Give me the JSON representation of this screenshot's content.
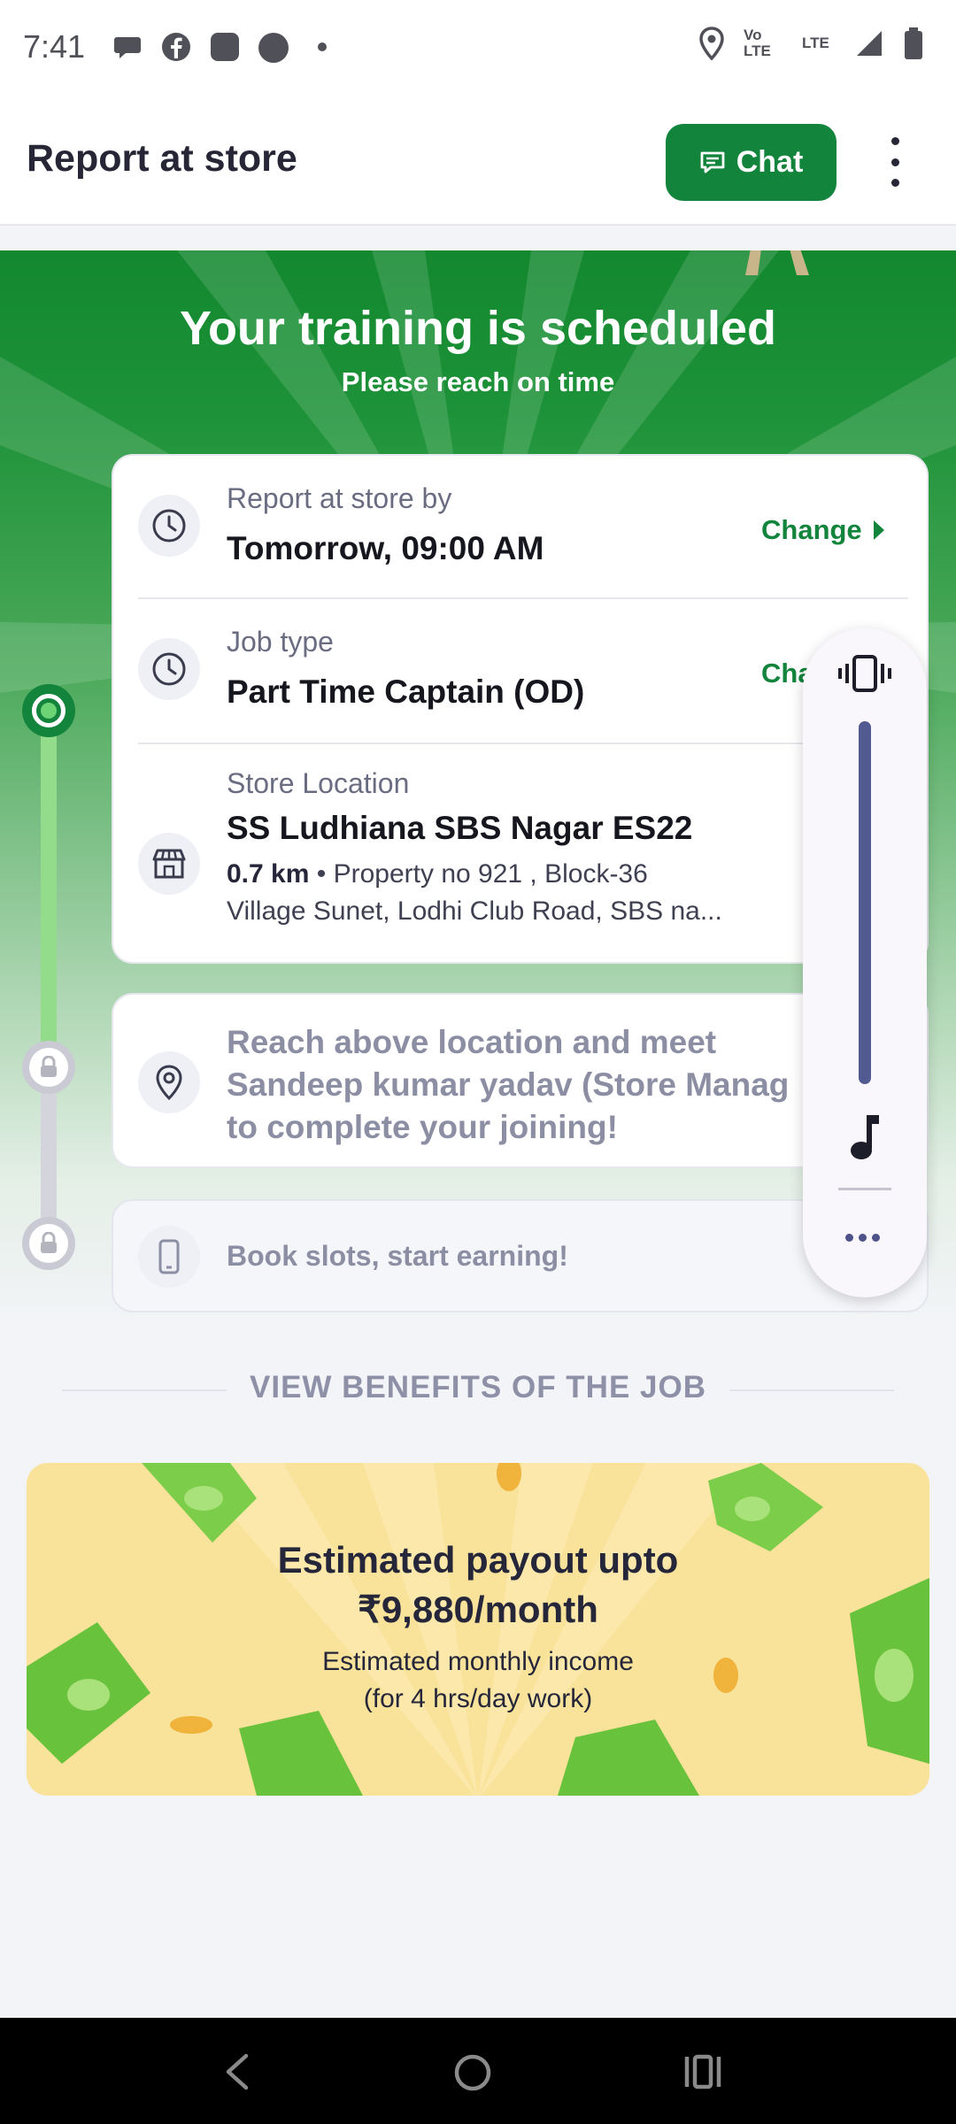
{
  "status_bar": {
    "time": "7:41",
    "notification_icons": [
      "chat-bubble-icon",
      "facebook-icon",
      "app-square-icon",
      "circle-app-icon",
      "dot-icon"
    ],
    "right_icons": [
      "location-icon",
      "volte-icon",
      "lte-icon",
      "signal-icon",
      "battery-icon"
    ],
    "volte_label": "Vo LTE",
    "lte_label": "LTE"
  },
  "header": {
    "title": "Report at store",
    "chat_label": "Chat"
  },
  "hero": {
    "title": "Your training is scheduled",
    "subtitle": "Please reach on time"
  },
  "details": {
    "report": {
      "label": "Report at store by",
      "value": "Tomorrow, 09:00 AM",
      "action": "Change"
    },
    "job": {
      "label": "Job type",
      "value": "Part Time Captain (OD)",
      "action": "Cha"
    },
    "store": {
      "label": "Store Location",
      "name": "SS Ludhiana SBS Nagar ES22",
      "distance": "0.7 km",
      "separator": "•",
      "address_line1": "Property no 921 , Block-36",
      "address_line2": "Village Sunet, Lodhi Club Road, SBS na..."
    }
  },
  "reach": {
    "line1": "Reach above location and meet",
    "line2": "Sandeep kumar yadav (Store Manag",
    "line3": "to complete your joining!"
  },
  "book": {
    "text": "Book slots, start earning!"
  },
  "benefits": {
    "label": "VIEW BENEFITS OF THE JOB"
  },
  "payout": {
    "title_line1": "Estimated payout upto",
    "title_line2": "₹9,880/month",
    "sub_line1": "Estimated monthly income",
    "sub_line2": "(for 4 hrs/day work)"
  },
  "colors": {
    "brand_green": "#13843c",
    "volume_track": "#525a92",
    "banner_yellow": "#f9e29a"
  }
}
